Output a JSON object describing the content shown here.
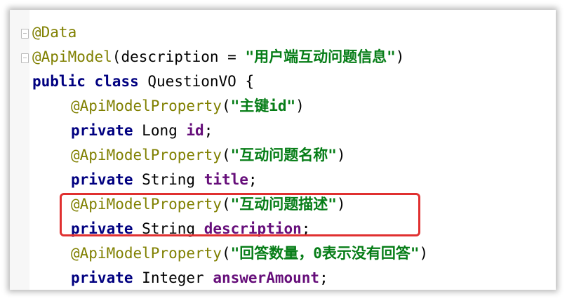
{
  "code": {
    "line1": {
      "annotation": "@Data"
    },
    "line2": {
      "annotation": "@ApiModel",
      "open": "(",
      "attr": "description = ",
      "value": "\"用户端互动问题信息\"",
      "close": ")"
    },
    "line3": {
      "kw1": "public",
      "kw2": "class",
      "name": "QuestionVO {"
    },
    "line4": {
      "annotation": "@ApiModelProperty",
      "open": "(",
      "value": "\"主键id\"",
      "close": ")"
    },
    "line5": {
      "kw": "private",
      "type": "Long",
      "field": "id",
      "end": ";"
    },
    "line6": {
      "annotation": "@ApiModelProperty",
      "open": "(",
      "value": "\"互动问题名称\"",
      "close": ")"
    },
    "line7": {
      "kw": "private",
      "type": "String",
      "field": "title",
      "end": ";"
    },
    "line8": {
      "annotation": "@ApiModelProperty",
      "open": "(",
      "value": "\"互动问题描述\"",
      "close": ")"
    },
    "line9": {
      "kw": "private",
      "type": "String",
      "field": "description",
      "end": ";"
    },
    "line10": {
      "annotation": "@ApiModelProperty",
      "open": "(",
      "value": "\"回答数量，0表示没有回答\"",
      "close": ")"
    },
    "line11": {
      "kw": "private",
      "type": "Integer",
      "field": "answerAmount",
      "end": ";"
    }
  },
  "colors": {
    "annotation": "#808000",
    "keyword": "#000080",
    "string": "#067d17",
    "field": "#660e7a",
    "highlight_border": "#e03030"
  }
}
